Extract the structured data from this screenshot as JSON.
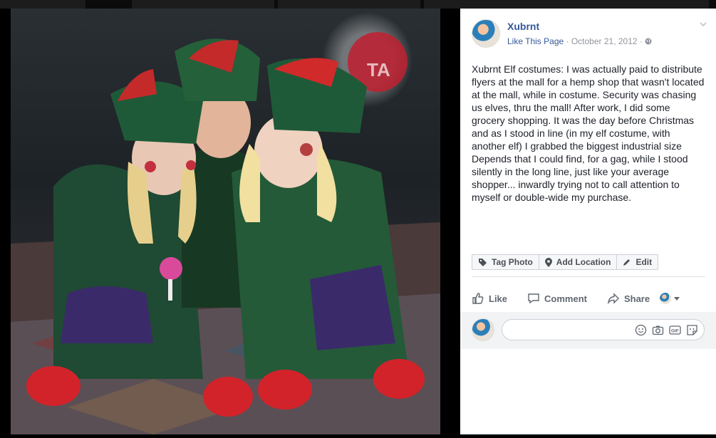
{
  "post": {
    "page_name": "Xubrnt",
    "like_link": "Like This Page",
    "separator": " · ",
    "date": "October 21, 2012",
    "privacy_sep": " · ",
    "privacy_icon": "globe-icon",
    "caption": "Xubrnt Elf costumes: I was actually paid to distribute flyers at the mall for a hemp shop that wasn't located at the mall, while in costume. Security was chasing us elves, thru the mall! After work, I did some grocery shopping. It was the day before Christmas and as I stood in line (in my elf costume, with another elf) I grabbed the biggest industrial size Depends that I could find, for a gag, while I stood silently in the long line, just like your average shopper... inwardly trying not to call attention to myself or double-wide my purchase."
  },
  "photo_tools": {
    "tag": "Tag Photo",
    "location": "Add Location",
    "edit": "Edit"
  },
  "actions": {
    "like": "Like",
    "comment": "Comment",
    "share": "Share"
  },
  "comment_box": {
    "placeholder": "",
    "icons": [
      "emoji-icon",
      "camera-icon",
      "gif-icon",
      "sticker-icon"
    ]
  },
  "colors": {
    "link": "#365899",
    "meta": "#90949c",
    "text": "#1d2129",
    "action": "#606770"
  }
}
